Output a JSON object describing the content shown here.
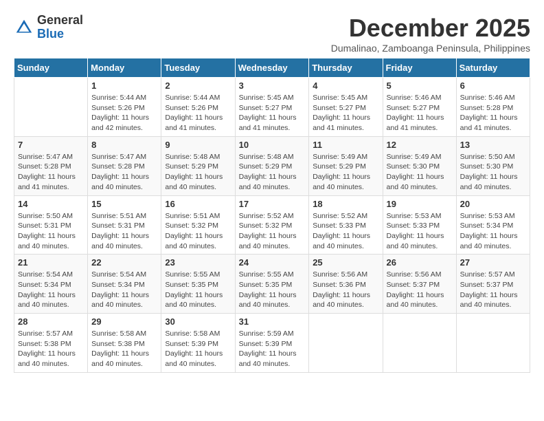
{
  "logo": {
    "general": "General",
    "blue": "Blue"
  },
  "title": "December 2025",
  "subtitle": "Dumalinao, Zamboanga Peninsula, Philippines",
  "days_of_week": [
    "Sunday",
    "Monday",
    "Tuesday",
    "Wednesday",
    "Thursday",
    "Friday",
    "Saturday"
  ],
  "weeks": [
    [
      {
        "day": "",
        "sunrise": "",
        "sunset": "",
        "daylight": ""
      },
      {
        "day": "1",
        "sunrise": "Sunrise: 5:44 AM",
        "sunset": "Sunset: 5:26 PM",
        "daylight": "Daylight: 11 hours and 42 minutes."
      },
      {
        "day": "2",
        "sunrise": "Sunrise: 5:44 AM",
        "sunset": "Sunset: 5:26 PM",
        "daylight": "Daylight: 11 hours and 41 minutes."
      },
      {
        "day": "3",
        "sunrise": "Sunrise: 5:45 AM",
        "sunset": "Sunset: 5:27 PM",
        "daylight": "Daylight: 11 hours and 41 minutes."
      },
      {
        "day": "4",
        "sunrise": "Sunrise: 5:45 AM",
        "sunset": "Sunset: 5:27 PM",
        "daylight": "Daylight: 11 hours and 41 minutes."
      },
      {
        "day": "5",
        "sunrise": "Sunrise: 5:46 AM",
        "sunset": "Sunset: 5:27 PM",
        "daylight": "Daylight: 11 hours and 41 minutes."
      },
      {
        "day": "6",
        "sunrise": "Sunrise: 5:46 AM",
        "sunset": "Sunset: 5:28 PM",
        "daylight": "Daylight: 11 hours and 41 minutes."
      }
    ],
    [
      {
        "day": "7",
        "sunrise": "Sunrise: 5:47 AM",
        "sunset": "Sunset: 5:28 PM",
        "daylight": "Daylight: 11 hours and 41 minutes."
      },
      {
        "day": "8",
        "sunrise": "Sunrise: 5:47 AM",
        "sunset": "Sunset: 5:28 PM",
        "daylight": "Daylight: 11 hours and 40 minutes."
      },
      {
        "day": "9",
        "sunrise": "Sunrise: 5:48 AM",
        "sunset": "Sunset: 5:29 PM",
        "daylight": "Daylight: 11 hours and 40 minutes."
      },
      {
        "day": "10",
        "sunrise": "Sunrise: 5:48 AM",
        "sunset": "Sunset: 5:29 PM",
        "daylight": "Daylight: 11 hours and 40 minutes."
      },
      {
        "day": "11",
        "sunrise": "Sunrise: 5:49 AM",
        "sunset": "Sunset: 5:29 PM",
        "daylight": "Daylight: 11 hours and 40 minutes."
      },
      {
        "day": "12",
        "sunrise": "Sunrise: 5:49 AM",
        "sunset": "Sunset: 5:30 PM",
        "daylight": "Daylight: 11 hours and 40 minutes."
      },
      {
        "day": "13",
        "sunrise": "Sunrise: 5:50 AM",
        "sunset": "Sunset: 5:30 PM",
        "daylight": "Daylight: 11 hours and 40 minutes."
      }
    ],
    [
      {
        "day": "14",
        "sunrise": "Sunrise: 5:50 AM",
        "sunset": "Sunset: 5:31 PM",
        "daylight": "Daylight: 11 hours and 40 minutes."
      },
      {
        "day": "15",
        "sunrise": "Sunrise: 5:51 AM",
        "sunset": "Sunset: 5:31 PM",
        "daylight": "Daylight: 11 hours and 40 minutes."
      },
      {
        "day": "16",
        "sunrise": "Sunrise: 5:51 AM",
        "sunset": "Sunset: 5:32 PM",
        "daylight": "Daylight: 11 hours and 40 minutes."
      },
      {
        "day": "17",
        "sunrise": "Sunrise: 5:52 AM",
        "sunset": "Sunset: 5:32 PM",
        "daylight": "Daylight: 11 hours and 40 minutes."
      },
      {
        "day": "18",
        "sunrise": "Sunrise: 5:52 AM",
        "sunset": "Sunset: 5:33 PM",
        "daylight": "Daylight: 11 hours and 40 minutes."
      },
      {
        "day": "19",
        "sunrise": "Sunrise: 5:53 AM",
        "sunset": "Sunset: 5:33 PM",
        "daylight": "Daylight: 11 hours and 40 minutes."
      },
      {
        "day": "20",
        "sunrise": "Sunrise: 5:53 AM",
        "sunset": "Sunset: 5:34 PM",
        "daylight": "Daylight: 11 hours and 40 minutes."
      }
    ],
    [
      {
        "day": "21",
        "sunrise": "Sunrise: 5:54 AM",
        "sunset": "Sunset: 5:34 PM",
        "daylight": "Daylight: 11 hours and 40 minutes."
      },
      {
        "day": "22",
        "sunrise": "Sunrise: 5:54 AM",
        "sunset": "Sunset: 5:34 PM",
        "daylight": "Daylight: 11 hours and 40 minutes."
      },
      {
        "day": "23",
        "sunrise": "Sunrise: 5:55 AM",
        "sunset": "Sunset: 5:35 PM",
        "daylight": "Daylight: 11 hours and 40 minutes."
      },
      {
        "day": "24",
        "sunrise": "Sunrise: 5:55 AM",
        "sunset": "Sunset: 5:35 PM",
        "daylight": "Daylight: 11 hours and 40 minutes."
      },
      {
        "day": "25",
        "sunrise": "Sunrise: 5:56 AM",
        "sunset": "Sunset: 5:36 PM",
        "daylight": "Daylight: 11 hours and 40 minutes."
      },
      {
        "day": "26",
        "sunrise": "Sunrise: 5:56 AM",
        "sunset": "Sunset: 5:37 PM",
        "daylight": "Daylight: 11 hours and 40 minutes."
      },
      {
        "day": "27",
        "sunrise": "Sunrise: 5:57 AM",
        "sunset": "Sunset: 5:37 PM",
        "daylight": "Daylight: 11 hours and 40 minutes."
      }
    ],
    [
      {
        "day": "28",
        "sunrise": "Sunrise: 5:57 AM",
        "sunset": "Sunset: 5:38 PM",
        "daylight": "Daylight: 11 hours and 40 minutes."
      },
      {
        "day": "29",
        "sunrise": "Sunrise: 5:58 AM",
        "sunset": "Sunset: 5:38 PM",
        "daylight": "Daylight: 11 hours and 40 minutes."
      },
      {
        "day": "30",
        "sunrise": "Sunrise: 5:58 AM",
        "sunset": "Sunset: 5:39 PM",
        "daylight": "Daylight: 11 hours and 40 minutes."
      },
      {
        "day": "31",
        "sunrise": "Sunrise: 5:59 AM",
        "sunset": "Sunset: 5:39 PM",
        "daylight": "Daylight: 11 hours and 40 minutes."
      },
      {
        "day": "",
        "sunrise": "",
        "sunset": "",
        "daylight": ""
      },
      {
        "day": "",
        "sunrise": "",
        "sunset": "",
        "daylight": ""
      },
      {
        "day": "",
        "sunrise": "",
        "sunset": "",
        "daylight": ""
      }
    ]
  ]
}
